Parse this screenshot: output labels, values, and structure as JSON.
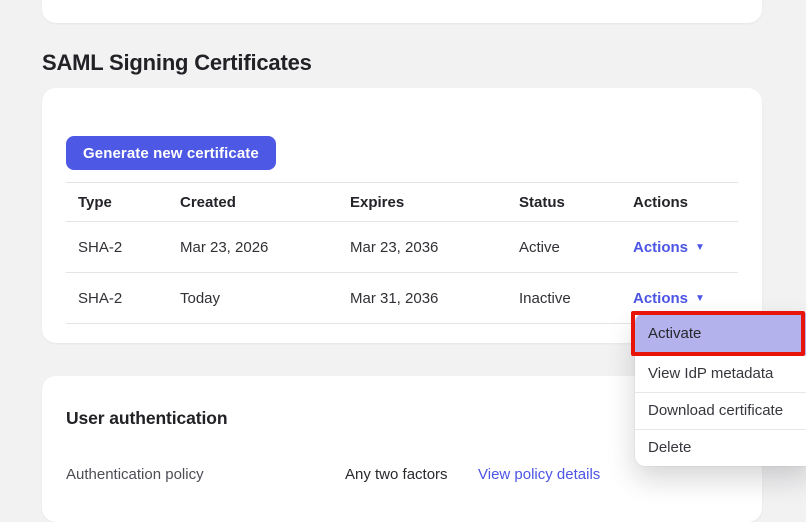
{
  "page_title": "SAML Signing Certificates",
  "icons": {
    "caret_down": "▼"
  },
  "colors": {
    "page_bg": "#f2f2f3",
    "accent_indigo": "#4c55e4",
    "button_indigo": "#4d58e4",
    "menu_highlight_purple": "#b4b2ec",
    "annotation_red": "#e91409",
    "table_border": "#e4e4e7"
  },
  "certificates": {
    "generate_button_label": "Generate new certificate",
    "table": {
      "columns": [
        "Type",
        "Created",
        "Expires",
        "Status",
        "Actions"
      ],
      "rows": [
        {
          "type": "SHA-2",
          "created": "Mar 23, 2026",
          "expires": "Mar 23, 2036",
          "status": "Active",
          "actions_label": "Actions"
        },
        {
          "type": "SHA-2",
          "created": "Today",
          "expires": "Mar 31, 2036",
          "status": "Inactive",
          "actions_label": "Actions"
        }
      ]
    }
  },
  "actions_menu": {
    "highlighted_item": "Activate",
    "items": [
      {
        "label": "Activate"
      },
      {
        "label": "View IdP metadata"
      },
      {
        "label": "Download certificate"
      },
      {
        "label": "Delete"
      }
    ]
  },
  "user_authentication": {
    "title": "User authentication",
    "policy_label": "Authentication policy",
    "policy_value": "Any two factors",
    "policy_link": "View policy details"
  }
}
